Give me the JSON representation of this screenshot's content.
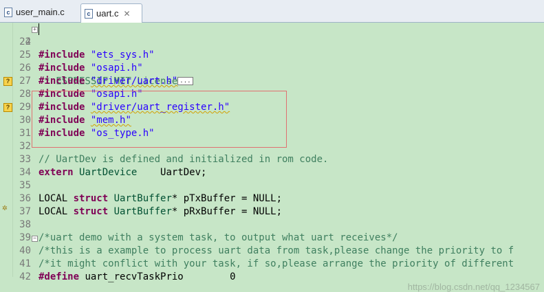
{
  "tabs": [
    {
      "label": "user_main.c",
      "icon": "c-file-icon",
      "active": false
    },
    {
      "label": "uart.c",
      "icon": "c-file-icon",
      "active": true,
      "close": "✕"
    }
  ],
  "license_line": {
    "number": "2",
    "text": " * ESPRESSIF MIT License",
    "collapsed": "..."
  },
  "lines": [
    {
      "n": "24",
      "text": ""
    },
    {
      "n": "25",
      "kw": "#include",
      "str": "\"ets_sys.h\""
    },
    {
      "n": "26",
      "kw": "#include",
      "str": "\"osapi.h\""
    },
    {
      "n": "27",
      "kw": "#include",
      "str": "\"driver/uart.h\""
    },
    {
      "n": "28",
      "kw": "#include",
      "str": "\"osapi.h\""
    },
    {
      "n": "29",
      "kw": "#include",
      "str": "\"driver/uart_register.h\""
    },
    {
      "n": "30",
      "kw": "#include",
      "str": "\"mem.h\""
    },
    {
      "n": "31",
      "kw": "#include",
      "str": "\"os_type.h\""
    },
    {
      "n": "32",
      "text": ""
    },
    {
      "n": "33",
      "cm": "// UartDev is defined and initialized in rom code."
    },
    {
      "n": "34",
      "kw": "extern",
      "type": "UartDevice",
      "rest": "    UartDev;"
    },
    {
      "n": "35",
      "text": ""
    },
    {
      "n": "36",
      "pre": "LOCAL ",
      "kw": "struct",
      "type": "UartBuffer",
      "rest": "* pTxBuffer = NULL;"
    },
    {
      "n": "37",
      "pre": "LOCAL ",
      "kw": "struct",
      "type": "UartBuffer",
      "rest": "* pRxBuffer = NULL;"
    },
    {
      "n": "38",
      "text": ""
    },
    {
      "n": "39",
      "cm": "/*uart demo with a system task, to output what uart receives*/"
    },
    {
      "n": "40",
      "cm": "/*this is a example to process uart data from task,please change the priority to f"
    },
    {
      "n": "41",
      "cm": "/*it might conflict with your task, if so,please arrange the priority of different"
    },
    {
      "n": "42",
      "kw": "#define",
      "rest": " uart_recvTaskPrio        0"
    }
  ],
  "markers": {
    "warn": "?",
    "bug": "✲"
  },
  "watermark": "https://blog.csdn.net/qq_1234567"
}
